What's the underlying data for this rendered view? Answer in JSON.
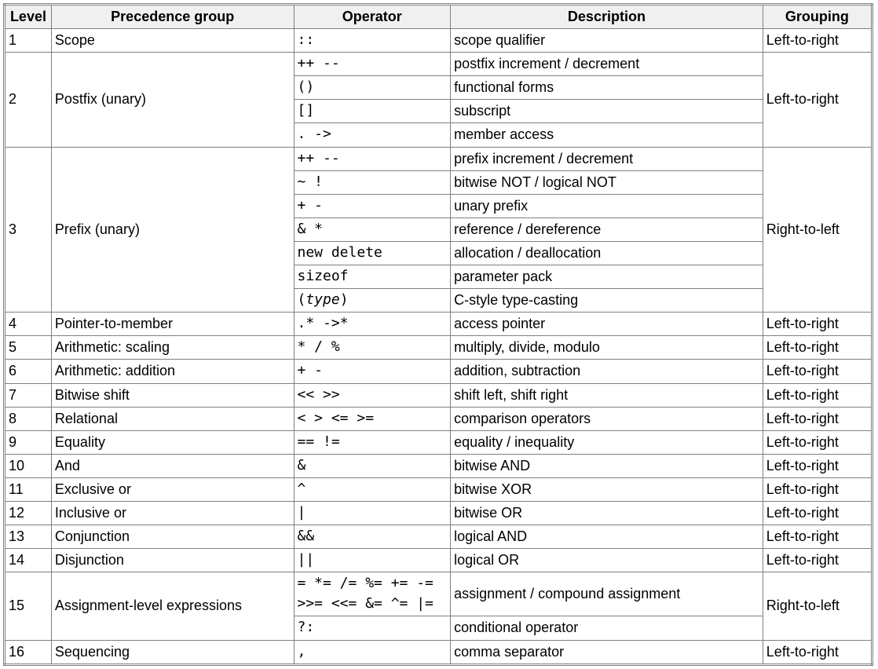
{
  "headers": {
    "level": "Level",
    "group": "Precedence group",
    "operator": "Operator",
    "description": "Description",
    "grouping": "Grouping"
  },
  "groupings": {
    "ltr": "Left-to-right",
    "rtl": "Right-to-left"
  },
  "type_keyword": "type",
  "levels": [
    {
      "level": "1",
      "group": "Scope",
      "grouping": "ltr",
      "rows": [
        {
          "operator": "::",
          "description": "scope qualifier"
        }
      ]
    },
    {
      "level": "2",
      "group": "Postfix (unary)",
      "grouping": "ltr",
      "rows": [
        {
          "operator": "++ --",
          "description": "postfix increment / decrement"
        },
        {
          "operator": "()",
          "description": "functional forms"
        },
        {
          "operator": "[]",
          "description": "subscript"
        },
        {
          "operator": ". ->",
          "description": "member access"
        }
      ]
    },
    {
      "level": "3",
      "group": "Prefix (unary)",
      "grouping": "rtl",
      "rows": [
        {
          "operator": "++ --",
          "description": "prefix increment / decrement"
        },
        {
          "operator": "~ !",
          "description": "bitwise NOT / logical NOT"
        },
        {
          "operator": "+ -",
          "description": "unary prefix"
        },
        {
          "operator": "& *",
          "description": "reference / dereference"
        },
        {
          "operator": "new delete",
          "description": "allocation / deallocation"
        },
        {
          "operator": "sizeof",
          "description": "parameter pack"
        },
        {
          "operator": "__TYPE__",
          "description": "C-style type-casting"
        }
      ]
    },
    {
      "level": "4",
      "group": "Pointer-to-member",
      "grouping": "ltr",
      "rows": [
        {
          "operator": ".* ->*",
          "description": "access pointer"
        }
      ]
    },
    {
      "level": "5",
      "group": "Arithmetic: scaling",
      "grouping": "ltr",
      "rows": [
        {
          "operator": "* / %",
          "description": "multiply, divide, modulo"
        }
      ]
    },
    {
      "level": "6",
      "group": "Arithmetic: addition",
      "grouping": "ltr",
      "rows": [
        {
          "operator": "+ -",
          "description": "addition, subtraction"
        }
      ]
    },
    {
      "level": "7",
      "group": "Bitwise shift",
      "grouping": "ltr",
      "rows": [
        {
          "operator": "<< >>",
          "description": "shift left, shift right"
        }
      ]
    },
    {
      "level": "8",
      "group": "Relational",
      "grouping": "ltr",
      "rows": [
        {
          "operator": "< > <= >=",
          "description": "comparison operators"
        }
      ]
    },
    {
      "level": "9",
      "group": "Equality",
      "grouping": "ltr",
      "rows": [
        {
          "operator": "== !=",
          "description": "equality / inequality"
        }
      ]
    },
    {
      "level": "10",
      "group": "And",
      "grouping": "ltr",
      "rows": [
        {
          "operator": "&",
          "description": "bitwise AND"
        }
      ]
    },
    {
      "level": "11",
      "group": "Exclusive or",
      "grouping": "ltr",
      "rows": [
        {
          "operator": "^",
          "description": "bitwise XOR"
        }
      ]
    },
    {
      "level": "12",
      "group": "Inclusive or",
      "grouping": "ltr",
      "rows": [
        {
          "operator": "|",
          "description": "bitwise OR"
        }
      ]
    },
    {
      "level": "13",
      "group": "Conjunction",
      "grouping": "ltr",
      "rows": [
        {
          "operator": "&&",
          "description": "logical AND"
        }
      ]
    },
    {
      "level": "14",
      "group": "Disjunction",
      "grouping": "ltr",
      "rows": [
        {
          "operator": "||",
          "description": "logical OR"
        }
      ]
    },
    {
      "level": "15",
      "group": "Assignment-level expressions",
      "grouping": "rtl",
      "rows": [
        {
          "operator": "= *= /= %= += -=\n>>= <<= &= ^= |=",
          "description": "assignment / compound assignment"
        },
        {
          "operator": "?:",
          "description": "conditional operator"
        }
      ]
    },
    {
      "level": "16",
      "group": "Sequencing",
      "grouping": "ltr",
      "rows": [
        {
          "operator": ",",
          "description": "comma separator"
        }
      ]
    }
  ]
}
